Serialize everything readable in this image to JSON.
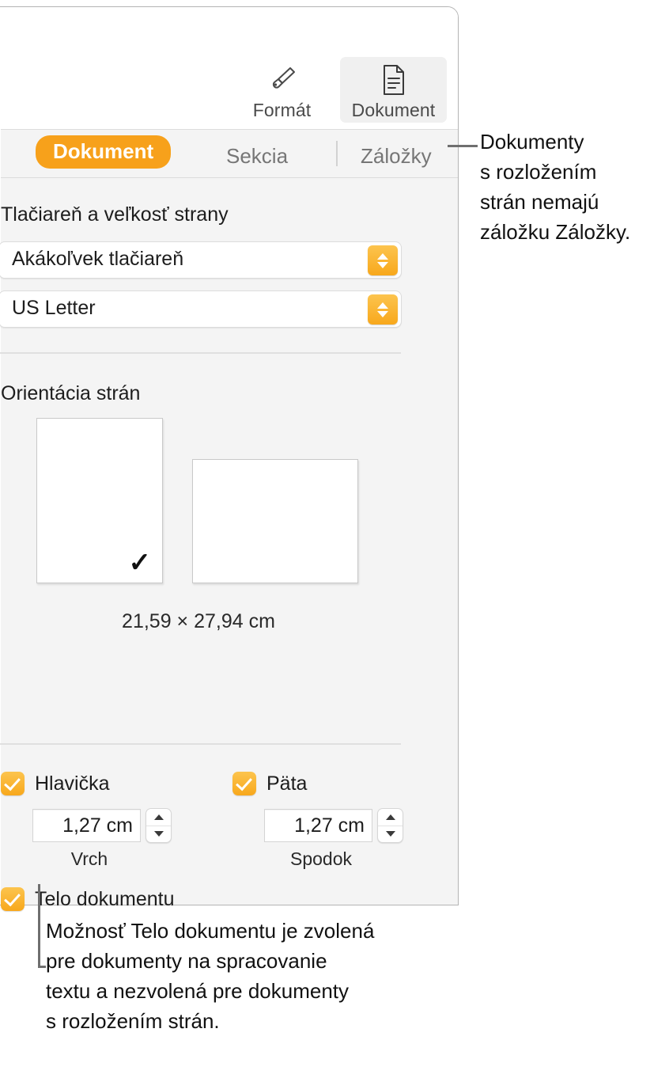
{
  "toolbar": {
    "items": [
      {
        "label": "Formát",
        "icon": "paintbrush-icon",
        "selected": false
      },
      {
        "label": "Dokument",
        "icon": "document-page-icon",
        "selected": true
      }
    ]
  },
  "tabs": [
    {
      "label": "Dokument",
      "active": true
    },
    {
      "label": "Sekcia",
      "active": false
    },
    {
      "label": "Záložky",
      "active": false
    }
  ],
  "printer_section": {
    "title": "Tlačiareň a veľkosť strany",
    "printer_value": "Akákoľvek tlačiareň",
    "page_size_value": "US Letter"
  },
  "orientation_section": {
    "title": "Orientácia strán",
    "portrait_selected": true,
    "landscape_selected": false,
    "dimensions": "21,59 × 27,94 cm"
  },
  "header_footer": {
    "header": {
      "checkbox_label": "Hlavička",
      "checked": true,
      "value": "1,27 cm",
      "sub_label": "Vrch"
    },
    "footer": {
      "checkbox_label": "Päta",
      "checked": true,
      "value": "1,27 cm",
      "sub_label": "Spodok"
    },
    "body": {
      "checkbox_label": "Telo dokumentu",
      "checked": true
    }
  },
  "callouts": {
    "top": "Dokumenty\ns rozložením\nstrán nemajú\nzáložku Záložky.",
    "bottom": "Možnosť Telo dokumentu je zvolená\npre dokumenty na spracovanie\ntextu a nezvolená pre dokumenty\ns rozložením strán."
  },
  "colors": {
    "accent_orange": "#f7a11b",
    "panel_background": "#f4f4f4",
    "toolbar_background": "#ffffff",
    "border_gray": "#b4b4b4"
  }
}
